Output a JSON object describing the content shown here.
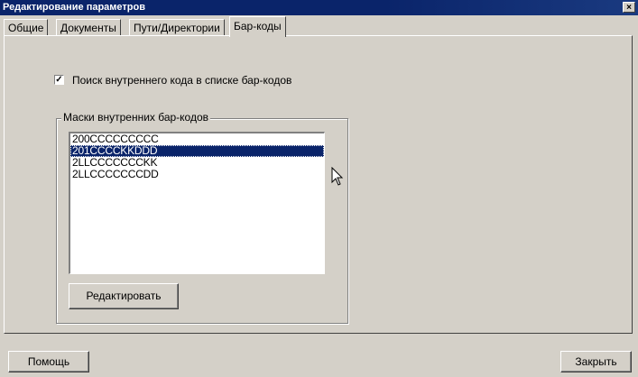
{
  "window": {
    "title": "Редактирование параметров",
    "close_glyph": "×"
  },
  "tabs": [
    {
      "label": "Общие",
      "active": false
    },
    {
      "label": "Документы",
      "active": false
    },
    {
      "label": "Пути/Директории",
      "active": false
    },
    {
      "label": "Бар-коды",
      "active": true
    }
  ],
  "barcode_tab": {
    "search_checkbox": {
      "label": "Поиск внутреннего кода в списке бар-кодов",
      "checked": true,
      "check_glyph": "✓"
    },
    "masks_group": {
      "label": "Маски внутренних бар-кодов",
      "items": [
        "200CCCCCCCCC",
        "201CCCCKKDDD",
        "2LLCCCCCCCKK",
        "2LLCCCCCCCDD"
      ],
      "selected_index": 1,
      "edit_button": "Редактировать"
    }
  },
  "footer": {
    "help_button": "Помощь",
    "close_button": "Закрыть"
  },
  "colors": {
    "face": "#d4d0c8",
    "titlebar": "#0a246a",
    "selection": "#0a246a"
  },
  "icons": {
    "cursor": "arrow-cursor-icon"
  }
}
